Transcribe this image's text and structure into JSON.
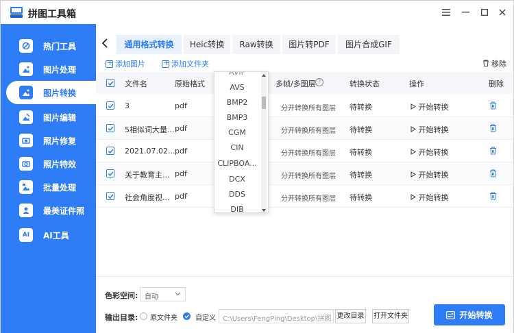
{
  "app": {
    "title": "拼图工具箱"
  },
  "sidebar": {
    "items": [
      {
        "label": "热门工具",
        "icon": "hot-tools-icon"
      },
      {
        "label": "图片处理",
        "icon": "image-process-icon"
      },
      {
        "label": "图片转换",
        "icon": "image-convert-icon",
        "active": true
      },
      {
        "label": "图片编辑",
        "icon": "image-edit-icon"
      },
      {
        "label": "照片修复",
        "icon": "photo-repair-icon"
      },
      {
        "label": "照片特效",
        "icon": "photo-effects-icon"
      },
      {
        "label": "批量处理",
        "icon": "batch-process-icon"
      },
      {
        "label": "最美证件照",
        "icon": "id-photo-icon"
      },
      {
        "label": "AI工具",
        "icon": "ai-tools-icon",
        "badge": "AI"
      }
    ]
  },
  "tabs": [
    {
      "label": "通用格式转换",
      "active": true
    },
    {
      "label": "Heic转换"
    },
    {
      "label": "Raw转换"
    },
    {
      "label": "图片转PDF"
    },
    {
      "label": "图片合成GIF"
    }
  ],
  "toolbar": {
    "add_image": "添加图片",
    "add_folder": "添加文件夹",
    "remove": "移除"
  },
  "table": {
    "headers": {
      "name": "文件名",
      "orig_format": "原始格式",
      "layers": "多帧/多图层",
      "status": "转换状态",
      "action": "操作",
      "delete": "删除"
    },
    "rows": [
      {
        "name": "3",
        "format": "pdf",
        "layers": "分开转换所有图层",
        "status": "待转换",
        "action": "开始转换"
      },
      {
        "name": "5相似词大量...",
        "format": "pdf",
        "layers": "分开转换所有图层",
        "status": "待转换",
        "action": "开始转换"
      },
      {
        "name": "2021.07.02...",
        "format": "pdf",
        "layers": "分开转换所有图层",
        "status": "待转换",
        "action": "开始转换"
      },
      {
        "name": "关于教育主...",
        "format": "pdf",
        "layers": "分开转换所有图层",
        "status": "待转换",
        "action": "开始转换"
      },
      {
        "name": "社会角度视...",
        "format": "pdf",
        "layers": "分开转换所有图层",
        "status": "待转换",
        "action": "开始转换"
      }
    ]
  },
  "dropdown": {
    "options": [
      "AVIF",
      "AVS",
      "BMP2",
      "BMP3",
      "CGM",
      "CIN",
      "CLIPBOA...",
      "DCX",
      "DDS",
      "DIB"
    ]
  },
  "bottom": {
    "color_space_label": "色彩空间:",
    "color_space_value": "自动",
    "output_label": "输出目录:",
    "opt_original": "原文件夹",
    "opt_custom": "自定义",
    "path": "C:\\Users\\FengPing\\Desktop\\拼图...",
    "change_dir": "更改目录",
    "open_folder": "打开文件夹",
    "start": "开始转换"
  },
  "colors": {
    "accent": "#2e7cf6"
  }
}
